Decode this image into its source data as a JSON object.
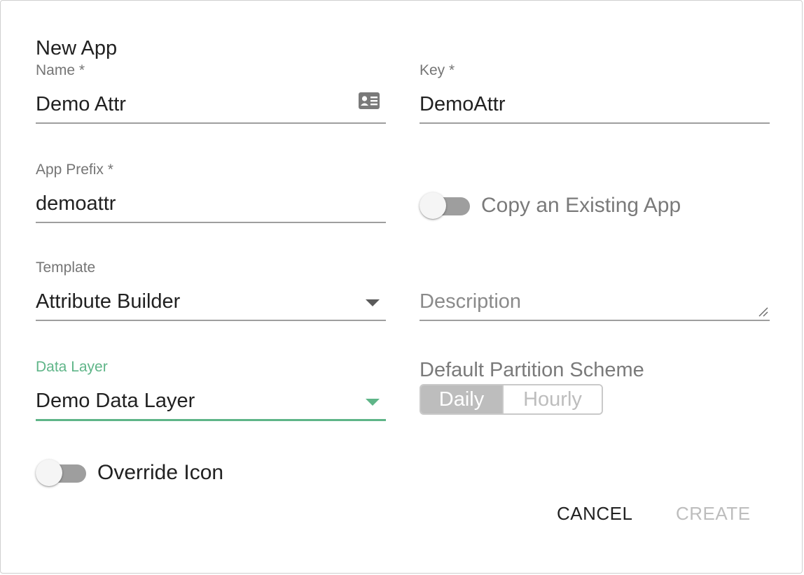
{
  "dialog": {
    "title": "New App"
  },
  "fields": {
    "name": {
      "label": "Name *",
      "value": "Demo Attr",
      "icon": "contact-card-icon"
    },
    "key": {
      "label": "Key *",
      "value": "DemoAttr"
    },
    "app_prefix": {
      "label": "App Prefix *",
      "value": "demoattr"
    },
    "template": {
      "label": "Template",
      "value": "Attribute Builder"
    },
    "description": {
      "placeholder": "Description"
    },
    "data_layer": {
      "label": "Data Layer",
      "value": "Demo Data Layer"
    }
  },
  "toggles": {
    "copy_existing": {
      "label": "Copy an Existing App",
      "checked": false
    },
    "override_icon": {
      "label": "Override Icon",
      "checked": false
    }
  },
  "partition": {
    "title": "Default Partition Scheme",
    "options": [
      "Daily",
      "Hourly"
    ],
    "selected": "Daily"
  },
  "actions": {
    "cancel_label": "CANCEL",
    "create_label": "CREATE"
  },
  "colors": {
    "accent": "#5fb588",
    "text": "#212121",
    "muted": "#757575",
    "disabled": "#bdbdbd",
    "toggle_track": "#9e9e9e"
  }
}
